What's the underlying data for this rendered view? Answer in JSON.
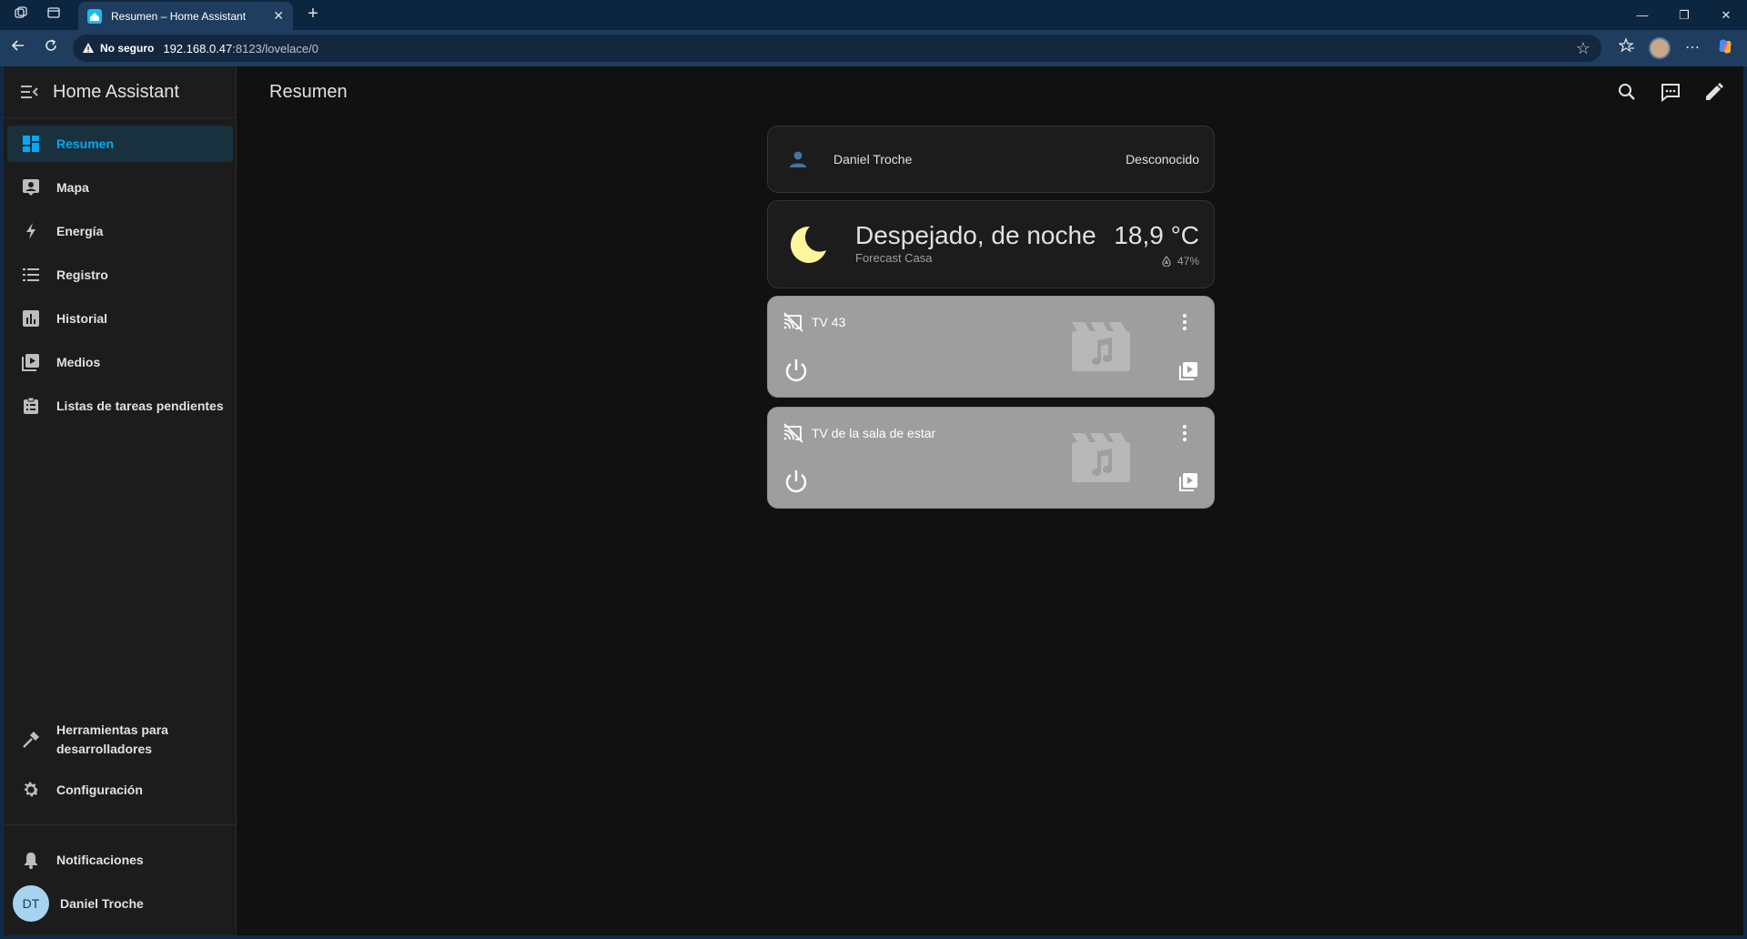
{
  "browser": {
    "tab_title": "Resumen – Home Assistant",
    "security_label": "No seguro",
    "url_host": "192.168.0.47",
    "url_path": ":8123/lovelace/0",
    "profile_initials": ""
  },
  "sidebar": {
    "title": "Home Assistant",
    "items": [
      {
        "label": "Resumen",
        "icon": "dashboard-icon",
        "active": true
      },
      {
        "label": "Mapa",
        "icon": "map-icon"
      },
      {
        "label": "Energía",
        "icon": "lightning-icon"
      },
      {
        "label": "Registro",
        "icon": "list-icon"
      },
      {
        "label": "Historial",
        "icon": "chart-icon"
      },
      {
        "label": "Medios",
        "icon": "media-icon"
      },
      {
        "label": "Listas de tareas pendientes",
        "icon": "clipboard-icon"
      }
    ],
    "dev_tools_line1": "Herramientas para",
    "dev_tools_line2": "desarrolladores",
    "settings": "Configuración",
    "notifications": "Notificaciones",
    "user_initials": "DT",
    "user_name": "Daniel Troche"
  },
  "header": {
    "title": "Resumen"
  },
  "cards": {
    "person": {
      "name": "Daniel Troche",
      "state": "Desconocido"
    },
    "weather": {
      "state": "Despejado, de noche",
      "name": "Forecast Casa",
      "temperature": "18,9 °C",
      "humidity": "47%"
    },
    "media": [
      {
        "name": "TV 43"
      },
      {
        "name": "TV de la sala de estar"
      }
    ]
  },
  "colors": {
    "accent": "#03a9f4",
    "sidebar_bg": "#1c1c1c",
    "main_bg": "#111111",
    "media_card_bg": "#9e9e9e",
    "moon": "#fff59d"
  }
}
